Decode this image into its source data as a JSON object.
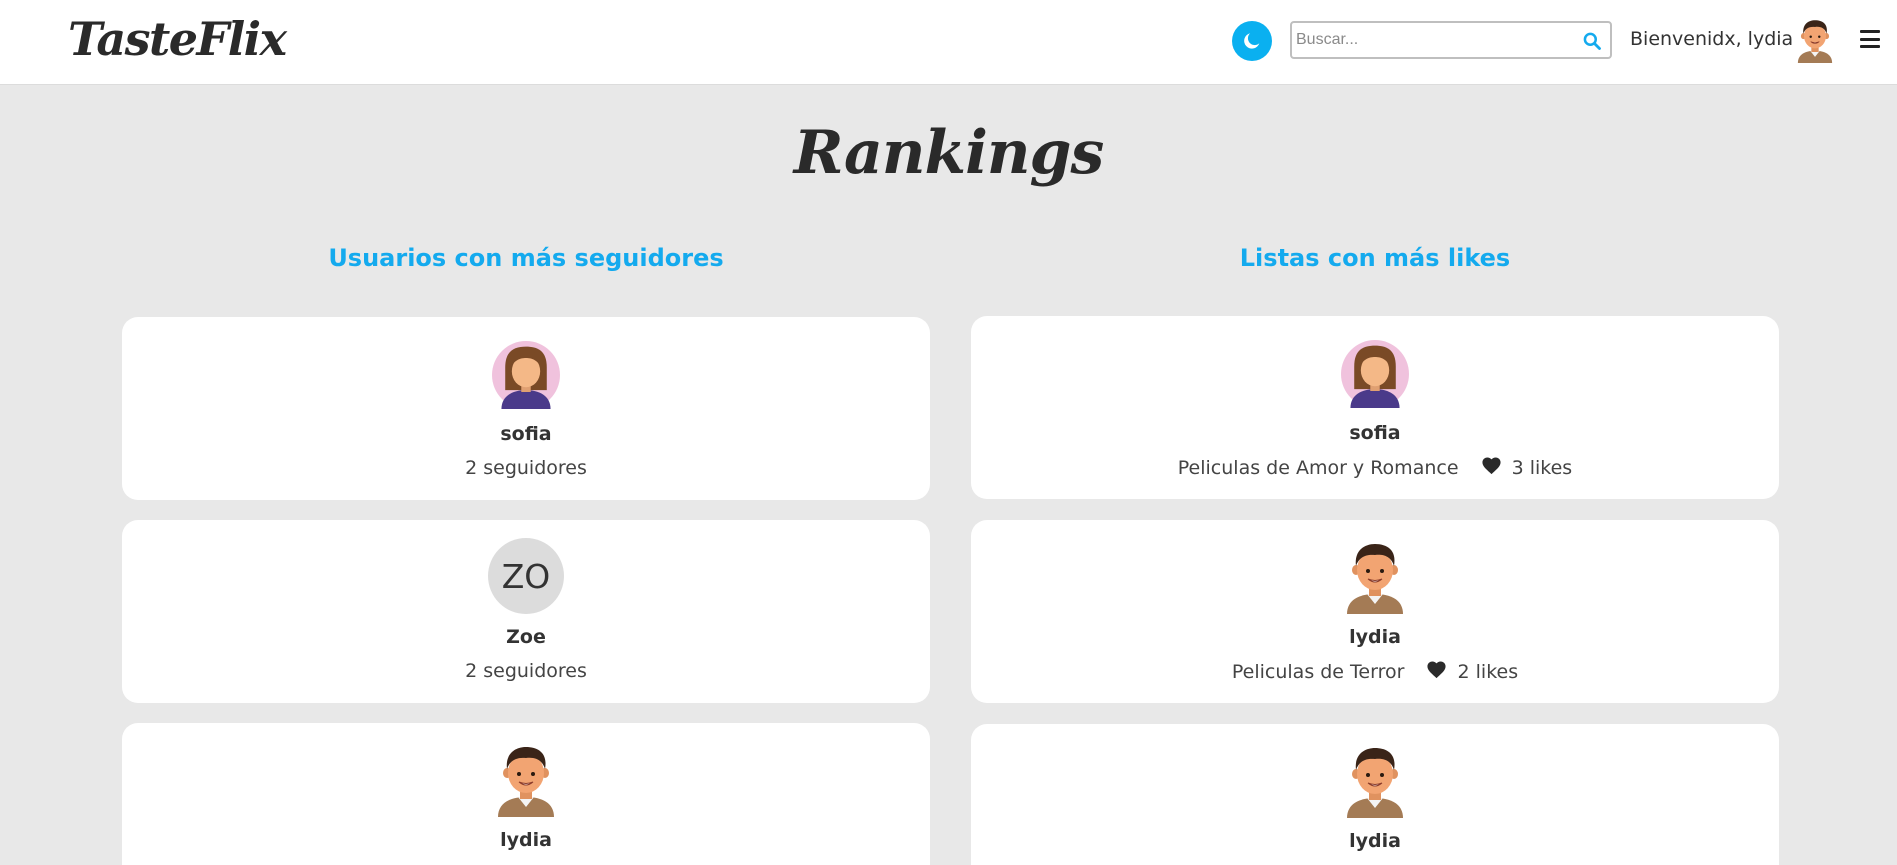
{
  "header": {
    "logo": "TasteFlix",
    "search_placeholder": "Buscar...",
    "welcome": "Bienvenidx, lydia",
    "theme_icon": "moon-icon",
    "search_icon": "search-icon",
    "menu_icon": "hamburger-menu-icon"
  },
  "page": {
    "title": "Rankings"
  },
  "colors": {
    "accent": "#14aaee",
    "toggle": "#0ab0f0",
    "background": "#e8e8e8"
  },
  "users_ranking": {
    "title": "Usuarios con más seguidores",
    "items": [
      {
        "name": "sofia",
        "followers": "2 seguidores",
        "avatar": "female-avatar"
      },
      {
        "name": "Zoe",
        "followers": "2 seguidores",
        "avatar_initials": "ZO"
      },
      {
        "name": "lydia",
        "followers": "",
        "avatar": "male-avatar"
      }
    ]
  },
  "lists_ranking": {
    "title": "Listas con más likes",
    "items": [
      {
        "owner": "sofia",
        "list_name": "Peliculas de Amor y Romance",
        "likes": "3 likes",
        "avatar": "female-avatar"
      },
      {
        "owner": "lydia",
        "list_name": "Peliculas de Terror",
        "likes": "2 likes",
        "avatar": "male-avatar"
      },
      {
        "owner": "lydia",
        "list_name": "",
        "likes": "",
        "avatar": "male-avatar"
      }
    ]
  }
}
